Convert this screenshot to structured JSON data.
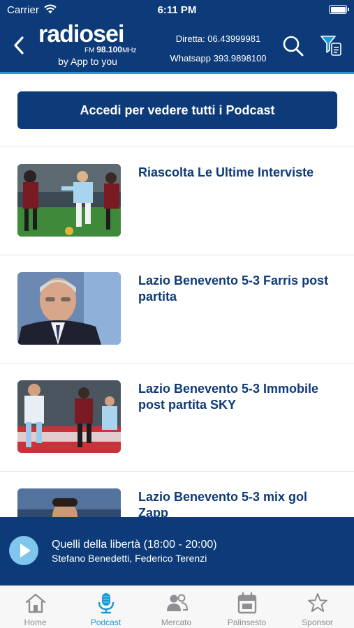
{
  "status_bar": {
    "carrier": "Carrier",
    "time": "6:11 PM"
  },
  "header": {
    "logo_text": "radiosei",
    "logo_freq_prefix": "FM",
    "logo_freq": "98.100",
    "logo_freq_unit": "MHz",
    "byline": "by App to you",
    "phone": "Diretta: 06.43999981",
    "whatsapp": "Whatsapp 393.9898100"
  },
  "login_button": "Accedi per vedere tutti i Podcast",
  "podcasts": [
    {
      "title": "Riascolta Le Ultime Interviste"
    },
    {
      "title": "Lazio Benevento 5-3 Farris post partita"
    },
    {
      "title": "Lazio Benevento 5-3 Immobile post partita SKY"
    },
    {
      "title": "Lazio Benevento 5-3 mix gol Zapp"
    }
  ],
  "player": {
    "show": "Quelli della libertà (18:00 - 20:00)",
    "hosts": "Stefano Benedetti, Federico Terenzi"
  },
  "tabs": [
    {
      "label": "Home",
      "icon": "home-icon",
      "active": false
    },
    {
      "label": "Podcast",
      "icon": "microphone-icon",
      "active": true
    },
    {
      "label": "Mercato",
      "icon": "people-icon",
      "active": false
    },
    {
      "label": "Palinsesto",
      "icon": "calendar-icon",
      "active": false
    },
    {
      "label": "Sponsor",
      "icon": "star-icon",
      "active": false
    }
  ],
  "colors": {
    "primary": "#0d3a78",
    "accent": "#1b9ad6",
    "tab_inactive": "#8e8e93"
  }
}
